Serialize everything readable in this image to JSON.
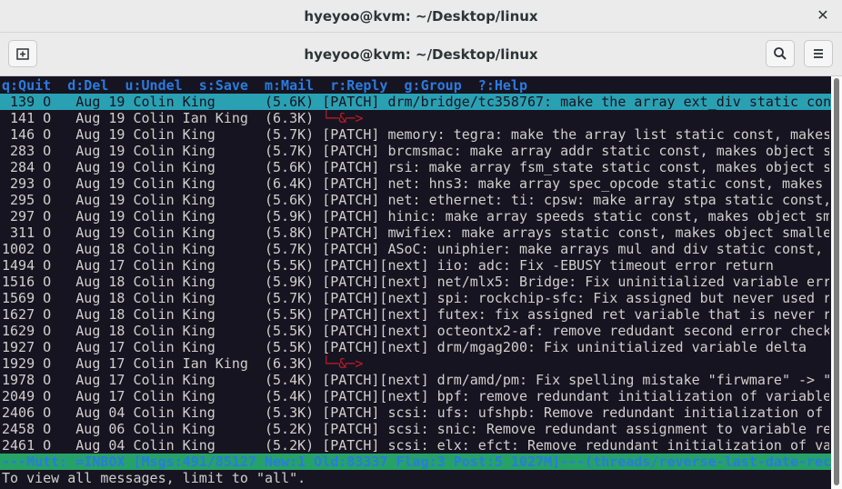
{
  "window": {
    "outer_title": "hyeyoo@kvm: ~/Desktop/linux",
    "header_title": "hyeyoo@kvm: ~/Desktop/linux",
    "close_glyph": "✕",
    "new_tab_icon": "new-tab-icon",
    "search_icon": "search-icon",
    "menu_icon": "hamburger-menu-icon"
  },
  "terminal": {
    "help_line": "q:Quit  d:Del  u:Undel  s:Save  m:Mail  r:Reply  g:Group  ?:Help",
    "messages": [
      {
        "num": " 139",
        "flag": "O",
        "date": "Aug 19",
        "author": "Colin King",
        "size": "(5.6K)",
        "subject": "[PATCH] drm/bridge/tc358767: make the array ext_div static con",
        "selected": true
      },
      {
        "num": " 141",
        "flag": "O",
        "date": "Aug 19",
        "author": "Colin Ian King",
        "size": "(6.3K)",
        "subject": "└─&─>",
        "thread": true
      },
      {
        "num": " 146",
        "flag": "O",
        "date": "Aug 19",
        "author": "Colin King",
        "size": "(5.7K)",
        "subject": "[PATCH] memory: tegra: make the array list static const, makes"
      },
      {
        "num": " 283",
        "flag": "O",
        "date": "Aug 19",
        "author": "Colin King",
        "size": "(5.7K)",
        "subject": "[PATCH] brcmsmac: make array addr static const, makes object s"
      },
      {
        "num": " 284",
        "flag": "O",
        "date": "Aug 19",
        "author": "Colin King",
        "size": "(5.6K)",
        "subject": "[PATCH] rsi: make array fsm_state static const, makes object s"
      },
      {
        "num": " 293",
        "flag": "O",
        "date": "Aug 19",
        "author": "Colin King",
        "size": "(6.4K)",
        "subject": "[PATCH] net: hns3: make array spec_opcode static const, makes "
      },
      {
        "num": " 295",
        "flag": "O",
        "date": "Aug 19",
        "author": "Colin King",
        "size": "(5.6K)",
        "subject": "[PATCH] net: ethernet: ti: cpsw: make array stpa static const,"
      },
      {
        "num": " 297",
        "flag": "O",
        "date": "Aug 19",
        "author": "Colin King",
        "size": "(5.9K)",
        "subject": "[PATCH] hinic: make array speeds static const, makes object sm"
      },
      {
        "num": " 311",
        "flag": "O",
        "date": "Aug 19",
        "author": "Colin King",
        "size": "(5.8K)",
        "subject": "[PATCH] mwifiex: make arrays static const, makes object smalle"
      },
      {
        "num": "1002",
        "flag": "O",
        "date": "Aug 18",
        "author": "Colin King",
        "size": "(5.7K)",
        "subject": "[PATCH] ASoC: uniphier: make arrays mul and div static const, "
      },
      {
        "num": "1494",
        "flag": "O",
        "date": "Aug 17",
        "author": "Colin King",
        "size": "(5.5K)",
        "subject": "[PATCH][next] iio: adc: Fix -EBUSY timeout error return"
      },
      {
        "num": "1516",
        "flag": "O",
        "date": "Aug 18",
        "author": "Colin King",
        "size": "(5.9K)",
        "subject": "[PATCH][next] net/mlx5: Bridge: Fix uninitialized variable err"
      },
      {
        "num": "1569",
        "flag": "O",
        "date": "Aug 18",
        "author": "Colin King",
        "size": "(5.7K)",
        "subject": "[PATCH][next] spi: rockchip-sfc: Fix assigned but never used r"
      },
      {
        "num": "1627",
        "flag": "O",
        "date": "Aug 18",
        "author": "Colin King",
        "size": "(5.5K)",
        "subject": "[PATCH][next] futex: fix assigned ret variable that is never r"
      },
      {
        "num": "1629",
        "flag": "O",
        "date": "Aug 18",
        "author": "Colin King",
        "size": "(5.5K)",
        "subject": "[PATCH][next] octeontx2-af: remove redudant second error check"
      },
      {
        "num": "1927",
        "flag": "O",
        "date": "Aug 17",
        "author": "Colin King",
        "size": "(5.5K)",
        "subject": "[PATCH][next] drm/mgag200: Fix uninitialized variable delta"
      },
      {
        "num": "1929",
        "flag": "O",
        "date": "Aug 17",
        "author": "Colin Ian King",
        "size": "(6.3K)",
        "subject": "└─&─>",
        "thread": true
      },
      {
        "num": "1978",
        "flag": "O",
        "date": "Aug 17",
        "author": "Colin King",
        "size": "(5.4K)",
        "subject": "[PATCH][next] drm/amd/pm: Fix spelling mistake \"firwmare\" -> \""
      },
      {
        "num": "2049",
        "flag": "O",
        "date": "Aug 17",
        "author": "Colin King",
        "size": "(5.4K)",
        "subject": "[PATCH][next] bpf: remove redundant initialization of variable"
      },
      {
        "num": "2406",
        "flag": "O",
        "date": "Aug 04",
        "author": "Colin King",
        "size": "(5.3K)",
        "subject": "[PATCH] scsi: ufs: ufshpb: Remove redundant initialization of "
      },
      {
        "num": "2458",
        "flag": "O",
        "date": "Aug 06",
        "author": "Colin King",
        "size": "(5.2K)",
        "subject": "[PATCH] scsi: snic: Remove redundant assignment to variable re"
      },
      {
        "num": "2461",
        "flag": "O",
        "date": "Aug 04",
        "author": "Colin King",
        "size": "(5.2K)",
        "subject": "[PATCH] scsi: elx: efct: Remove redundant initialization of va"
      }
    ],
    "status_line": "---Mutt: =INBOX [Msgs:491/85127 New:1 Old:83337 Flag:3 Post:5 1027M]---(threads/reverse-last-date-rec",
    "prompt_line": "To view all messages, limit to \"all\"."
  },
  "colors": {
    "terminal_bg": "#171421",
    "selected_bg": "#2aa1b3",
    "status_bg": "#26a269",
    "help_fg": "#2a7bde",
    "thread_arrow": "#c01c28"
  }
}
